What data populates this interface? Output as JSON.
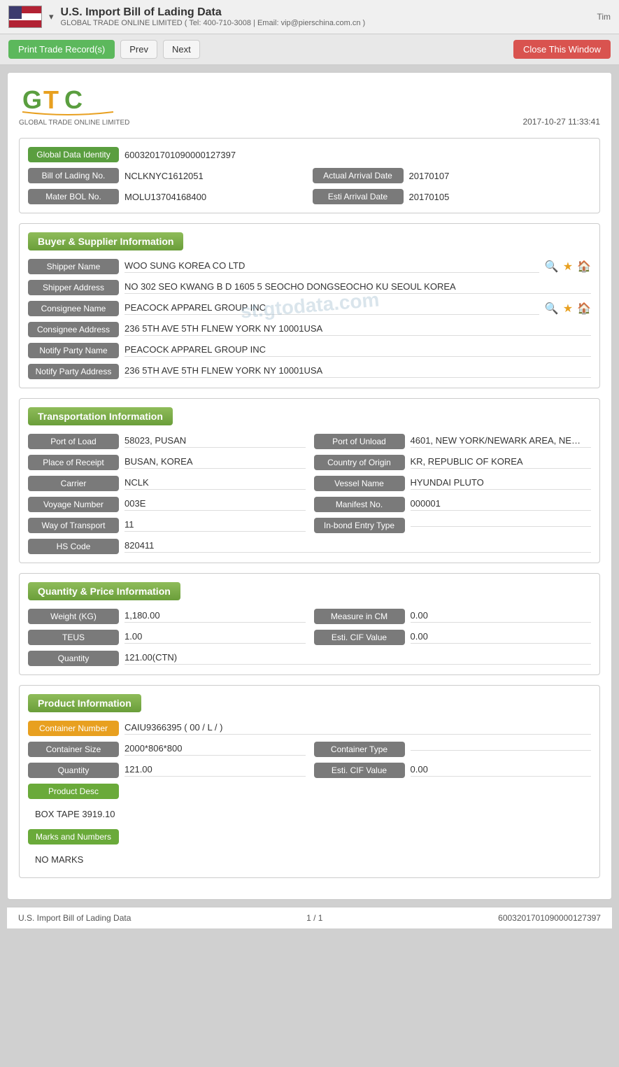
{
  "header": {
    "title": "U.S. Import Bill of Lading Data",
    "subtitle": "GLOBAL TRADE ONLINE LIMITED ( Tel: 400-710-3008 | Email: vip@pierschina.com.cn )",
    "time_label": "Tim"
  },
  "toolbar": {
    "print_label": "Print Trade Record(s)",
    "prev_label": "Prev",
    "next_label": "Next",
    "close_label": "Close This Window"
  },
  "report": {
    "date": "2017-10-27 11:33:41",
    "logo_tagline": "GLOBAL TRADE ONLINE LIMITED"
  },
  "identity": {
    "global_data_identity_label": "Global Data Identity",
    "global_data_identity_value": "6003201701090000127397",
    "bill_of_lading_label": "Bill of Lading No.",
    "bill_of_lading_value": "NCLKNYC1612051",
    "actual_arrival_label": "Actual Arrival Date",
    "actual_arrival_value": "20170107",
    "master_bol_label": "Mater BOL No.",
    "master_bol_value": "MOLU13704168400",
    "esti_arrival_label": "Esti Arrival Date",
    "esti_arrival_value": "20170105"
  },
  "buyer_supplier": {
    "section_title": "Buyer & Supplier Information",
    "shipper_name_label": "Shipper Name",
    "shipper_name_value": "WOO SUNG KOREA CO LTD",
    "shipper_address_label": "Shipper Address",
    "shipper_address_value": "NO 302 SEO KWANG B D 1605 5 SEOCHO DONGSEOCHO KU SEOUL KOREA",
    "consignee_name_label": "Consignee Name",
    "consignee_name_value": "PEACOCK APPAREL GROUP INC",
    "consignee_address_label": "Consignee Address",
    "consignee_address_value": "236 5TH AVE 5TH FLNEW YORK NY 10001USA",
    "notify_party_name_label": "Notify Party Name",
    "notify_party_name_value": "PEACOCK APPAREL GROUP INC",
    "notify_party_address_label": "Notify Party Address",
    "notify_party_address_value": "236 5TH AVE 5TH FLNEW YORK NY 10001USA"
  },
  "transportation": {
    "section_title": "Transportation Information",
    "port_of_load_label": "Port of Load",
    "port_of_load_value": "58023, PUSAN",
    "port_of_unload_label": "Port of Unload",
    "port_of_unload_value": "4601, NEW YORK/NEWARK AREA, NE…",
    "place_of_receipt_label": "Place of Receipt",
    "place_of_receipt_value": "BUSAN, KOREA",
    "country_of_origin_label": "Country of Origin",
    "country_of_origin_value": "KR, REPUBLIC OF KOREA",
    "carrier_label": "Carrier",
    "carrier_value": "NCLK",
    "vessel_name_label": "Vessel Name",
    "vessel_name_value": "HYUNDAI PLUTO",
    "voyage_number_label": "Voyage Number",
    "voyage_number_value": "003E",
    "manifest_no_label": "Manifest No.",
    "manifest_no_value": "000001",
    "way_of_transport_label": "Way of Transport",
    "way_of_transport_value": "11",
    "in_bond_entry_label": "In-bond Entry Type",
    "in_bond_entry_value": "",
    "hs_code_label": "HS Code",
    "hs_code_value": "820411"
  },
  "quantity_price": {
    "section_title": "Quantity & Price Information",
    "weight_kg_label": "Weight (KG)",
    "weight_kg_value": "1,180.00",
    "measure_cm_label": "Measure in CM",
    "measure_cm_value": "0.00",
    "teus_label": "TEUS",
    "teus_value": "1.00",
    "esti_cif_label": "Esti. CIF Value",
    "esti_cif_value": "0.00",
    "quantity_label": "Quantity",
    "quantity_value": "121.00(CTN)"
  },
  "product_information": {
    "section_title": "Product Information",
    "container_number_label": "Container Number",
    "container_number_value": "CAIU9366395 ( 00 / L / )",
    "container_size_label": "Container Size",
    "container_size_value": "2000*806*800",
    "container_type_label": "Container Type",
    "container_type_value": "",
    "quantity_label": "Quantity",
    "quantity_value": "121.00",
    "esti_cif_label": "Esti. CIF Value",
    "esti_cif_value": "0.00",
    "product_desc_label": "Product Desc",
    "product_desc_value": "BOX TAPE 3919.10",
    "marks_and_numbers_label": "Marks and Numbers",
    "marks_and_numbers_value": "NO MARKS"
  },
  "footer": {
    "left": "U.S. Import Bill of Lading Data",
    "center": "1 / 1",
    "right": "6003201701090000127397"
  },
  "watermark": "st.gtodata.com"
}
